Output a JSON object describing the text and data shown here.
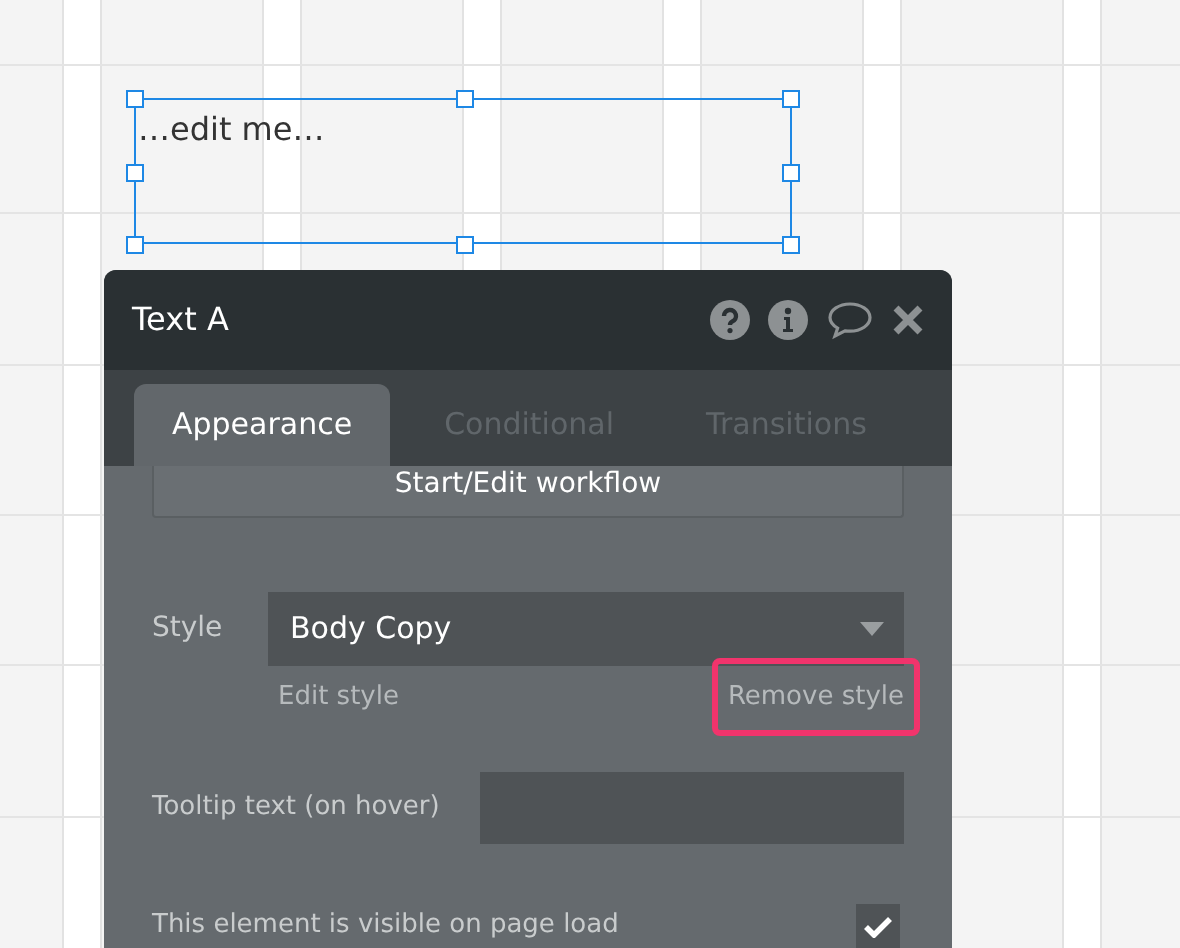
{
  "canvas": {
    "text_element": {
      "text": "…edit me…",
      "selected": true
    }
  },
  "panel": {
    "title": "Text A",
    "tabs": [
      {
        "label": "Appearance",
        "selected": true
      },
      {
        "label": "Conditional",
        "selected": false
      },
      {
        "label": "Transitions",
        "selected": false
      }
    ],
    "workflow_button": "Start/Edit workflow",
    "style": {
      "label": "Style",
      "value": "Body Copy",
      "edit_link": "Edit style",
      "remove_link": "Remove style",
      "remove_highlighted": true
    },
    "tooltip": {
      "label": "Tooltip text (on hover)"
    },
    "visible": {
      "label": "This element is visible on page load",
      "checked": true
    }
  }
}
